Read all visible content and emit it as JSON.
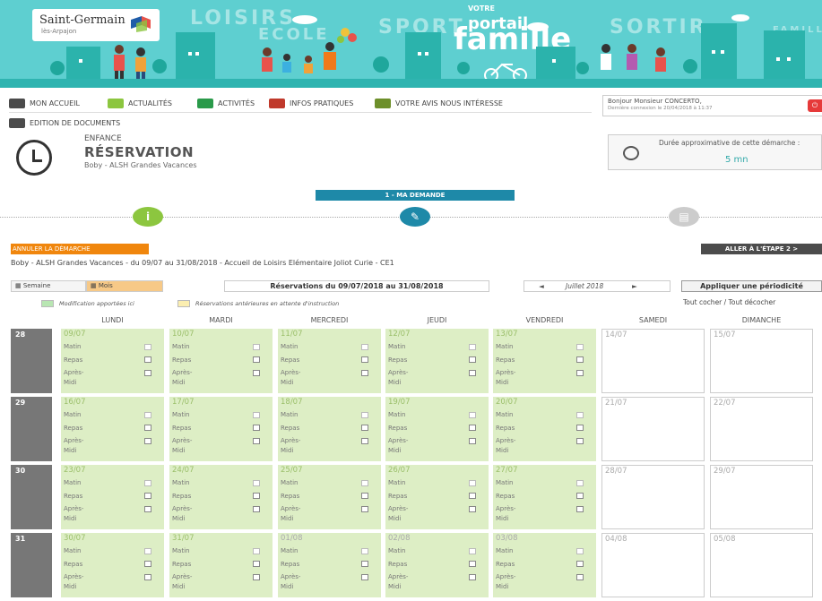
{
  "banner": {
    "logo_text": "Saint-Germain",
    "logo_sub": "lès-Arpajon",
    "words": [
      "LOISIRS",
      "ECOLE",
      "SPORT",
      "SORTIR",
      "FAMILLE"
    ],
    "portail_small": "VOTRE",
    "portail_mid": "portail",
    "portail_big": "famille",
    "colors": {
      "sky": "#5ecfd0",
      "buildings": "#2bb3ac"
    }
  },
  "nav": {
    "items": [
      {
        "label": "MON ACCUEIL",
        "icon": "home-icon"
      },
      {
        "label": "ACTUALITÉS",
        "icon": "news-icon"
      },
      {
        "label": "ACTIVITÉS",
        "icon": "activities-icon"
      },
      {
        "label": "INFOS PRATIQUES",
        "icon": "heart-icon"
      },
      {
        "label": "VOTRE AVIS NOUS INTÉRESSE",
        "icon": "chart-icon"
      },
      {
        "label": "EDITION DE DOCUMENTS",
        "icon": "documents-icon"
      }
    ]
  },
  "user": {
    "greeting": "Bonjour Monsieur CONCERTO,",
    "last_login": "Dernière connexion le 20/04/2018 à 11:37"
  },
  "page": {
    "section": "ENFANCE",
    "title": "RÉSERVATION",
    "subtitle": "Boby - ALSH Grandes Vacances"
  },
  "duration": {
    "label": "Durée approximative de cette démarche :",
    "value": "5 mn"
  },
  "steps": {
    "current_label": "1 - MA DEMANDE",
    "step1_icon": "info-icon",
    "step2_icon": "pencil-icon",
    "step3_icon": "document-icon",
    "colors": {
      "step1": "#8cc63f",
      "step2": "#1e89a8",
      "step3": "#cccccc"
    }
  },
  "actions": {
    "cancel": "ANNULER LA DÉMARCHE",
    "next": "ALLER À L'ÉTAPE 2 >"
  },
  "context": "Boby - ALSH Grandes Vacances - du 09/07 au 31/08/2018 - Accueil de Loisirs Elémentaire Joliot Curie - CE1",
  "toolbar": {
    "week": "Semaine",
    "month": "Mois",
    "period_title": "Réservations du 09/07/2018 au 31/08/2018",
    "prev": "◄",
    "month_label": "Juillet 2018",
    "next": "►",
    "periodicity": "Appliquer une périodicité"
  },
  "legend": {
    "modified": "Modification apportées ici",
    "pending": "Réservations antérieures en attente d'instruction",
    "colors": {
      "modified": "#b8e6b2",
      "pending": "#fbeeb0"
    }
  },
  "toggle_all": "Tout cocher / Tout décocher",
  "days": [
    "LUNDI",
    "MARDI",
    "MERCREDI",
    "JEUDI",
    "VENDREDI",
    "SAMEDI",
    "DIMANCHE"
  ],
  "slot_labels": {
    "matin": "Matin",
    "repas": "Repas",
    "apres1": "Après-",
    "apres2": "Midi"
  },
  "weeks": [
    {
      "num": "28",
      "dates": [
        "09/07",
        "10/07",
        "11/07",
        "12/07",
        "13/07"
      ],
      "weekend": [
        "14/07",
        "15/07"
      ]
    },
    {
      "num": "29",
      "dates": [
        "16/07",
        "17/07",
        "18/07",
        "19/07",
        "20/07"
      ],
      "weekend": [
        "21/07",
        "22/07"
      ]
    },
    {
      "num": "30",
      "dates": [
        "23/07",
        "24/07",
        "25/07",
        "26/07",
        "27/07"
      ],
      "weekend": [
        "28/07",
        "29/07"
      ]
    },
    {
      "num": "31",
      "dates": [
        "30/07",
        "31/07",
        "01/08",
        "02/08",
        "03/08"
      ],
      "weekend": [
        "04/08",
        "05/08"
      ]
    }
  ]
}
